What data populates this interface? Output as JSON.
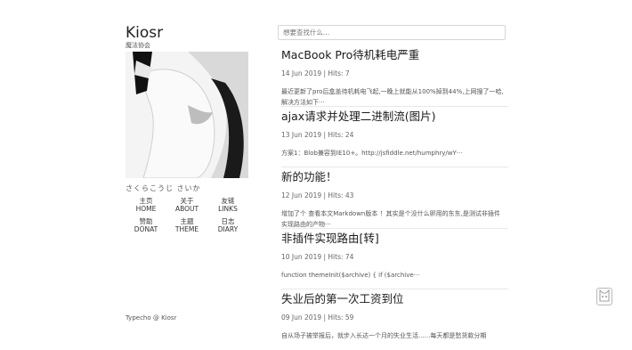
{
  "site": {
    "title": "Kiosr",
    "subtitle": "魔法协会"
  },
  "author": {
    "name": "さくらこうじ さいか"
  },
  "nav": [
    {
      "zh": "主页",
      "en": "HOME"
    },
    {
      "zh": "关于",
      "en": "ABOUT"
    },
    {
      "zh": "友链",
      "en": "LINKS"
    },
    {
      "zh": "赞助",
      "en": "DONAT"
    },
    {
      "zh": "主题",
      "en": "THEME"
    },
    {
      "zh": "日志",
      "en": "DIARY"
    }
  ],
  "footer": "Typecho @ Kiosr",
  "search": {
    "placeholder": "想要查找什么..."
  },
  "posts": [
    {
      "title": "MacBook Pro待机耗电严重",
      "meta": "14 Jun 2019 | Hits: 7",
      "excerpt": "最近更新了pro后盒盖待机耗电飞起,一晚上就能从100%掉到44%,上网搜了一哈,解决方法如下···"
    },
    {
      "title": "ajax请求并处理二进制流(图片)",
      "meta": "13 Jun 2019 | Hits: 24",
      "excerpt": "方案1：Blob兼容到IE10+。http://jsfiddle.net/humphry/wY···"
    },
    {
      "title": "新的功能！",
      "meta": "12 Jun 2019 | Hits: 43",
      "excerpt": "增加了个 查看本文Markdown版本 ！其实是个没什么卵用的东东,是测试非插件实现路由的产物···"
    },
    {
      "title": "非插件实现路由[转]",
      "meta": "10 Jun 2019 | Hits: 74",
      "excerpt": "function themeInit($archive) { if ($archive···"
    },
    {
      "title": "失业后的第一次工资到位",
      "meta": "09 Jun 2019 | Hits: 59",
      "excerpt": "自从场子被举报后，就步入长达一个月的失业生活......每天都是愁货款分期"
    }
  ]
}
